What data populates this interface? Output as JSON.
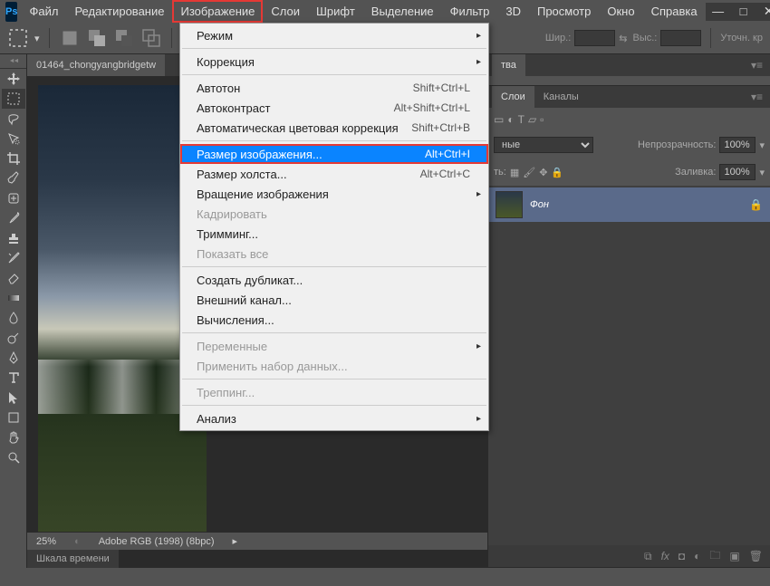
{
  "app": {
    "logo_text": "Ps"
  },
  "menubar": [
    "Файл",
    "Редактирование",
    "Изображение",
    "Слои",
    "Шрифт",
    "Выделение",
    "Фильтр",
    "3D",
    "Просмотр",
    "Окно",
    "Справка"
  ],
  "menubar_open_index": 2,
  "optionsbar": {
    "width_label": "Шир.:",
    "height_label": "Выс.:",
    "refine_label": "Уточн. кр"
  },
  "document": {
    "tab_title": "01464_chongyangbridgetw",
    "zoom": "25%",
    "color_profile": "Adobe RGB (1998) (8bpc)"
  },
  "timeline_tab": "Шкала времени",
  "panels": {
    "props_tab": "тва",
    "layers_tab": "Слои",
    "channels_tab": "Каналы",
    "kind_value": "ные",
    "opacity_label": "Непрозрачность:",
    "opacity_value": "100%",
    "lock_label": "ть:",
    "fill_label": "Заливка:",
    "fill_value": "100%",
    "bg_layer": "Фон"
  },
  "dropdown": {
    "items": [
      {
        "label": "Режим",
        "arrow": true
      },
      {
        "sep": true
      },
      {
        "label": "Коррекция",
        "arrow": true
      },
      {
        "sep": true
      },
      {
        "label": "Автотон",
        "shortcut": "Shift+Ctrl+L"
      },
      {
        "label": "Автоконтраст",
        "shortcut": "Alt+Shift+Ctrl+L"
      },
      {
        "label": "Автоматическая цветовая коррекция",
        "shortcut": "Shift+Ctrl+B"
      },
      {
        "sep": true
      },
      {
        "label": "Размер изображения...",
        "shortcut": "Alt+Ctrl+I",
        "hover": true,
        "highlight": true
      },
      {
        "label": "Размер холста...",
        "shortcut": "Alt+Ctrl+C"
      },
      {
        "label": "Вращение изображения",
        "arrow": true
      },
      {
        "label": "Кадрировать",
        "disabled": true
      },
      {
        "label": "Тримминг..."
      },
      {
        "label": "Показать все",
        "disabled": true
      },
      {
        "sep": true
      },
      {
        "label": "Создать дубликат..."
      },
      {
        "label": "Внешний канал..."
      },
      {
        "label": "Вычисления..."
      },
      {
        "sep": true
      },
      {
        "label": "Переменные",
        "arrow": true,
        "disabled": true
      },
      {
        "label": "Применить набор данных...",
        "disabled": true
      },
      {
        "sep": true
      },
      {
        "label": "Треппинг...",
        "disabled": true
      },
      {
        "sep": true
      },
      {
        "label": "Анализ",
        "arrow": true
      }
    ]
  },
  "icons": {
    "min": "—",
    "max": "□",
    "close": "✕",
    "link": "⧉",
    "swap": "⇆",
    "eye": "👁",
    "lock": "🔒",
    "arrow_r": "▸",
    "arrow_dd": "▾"
  }
}
